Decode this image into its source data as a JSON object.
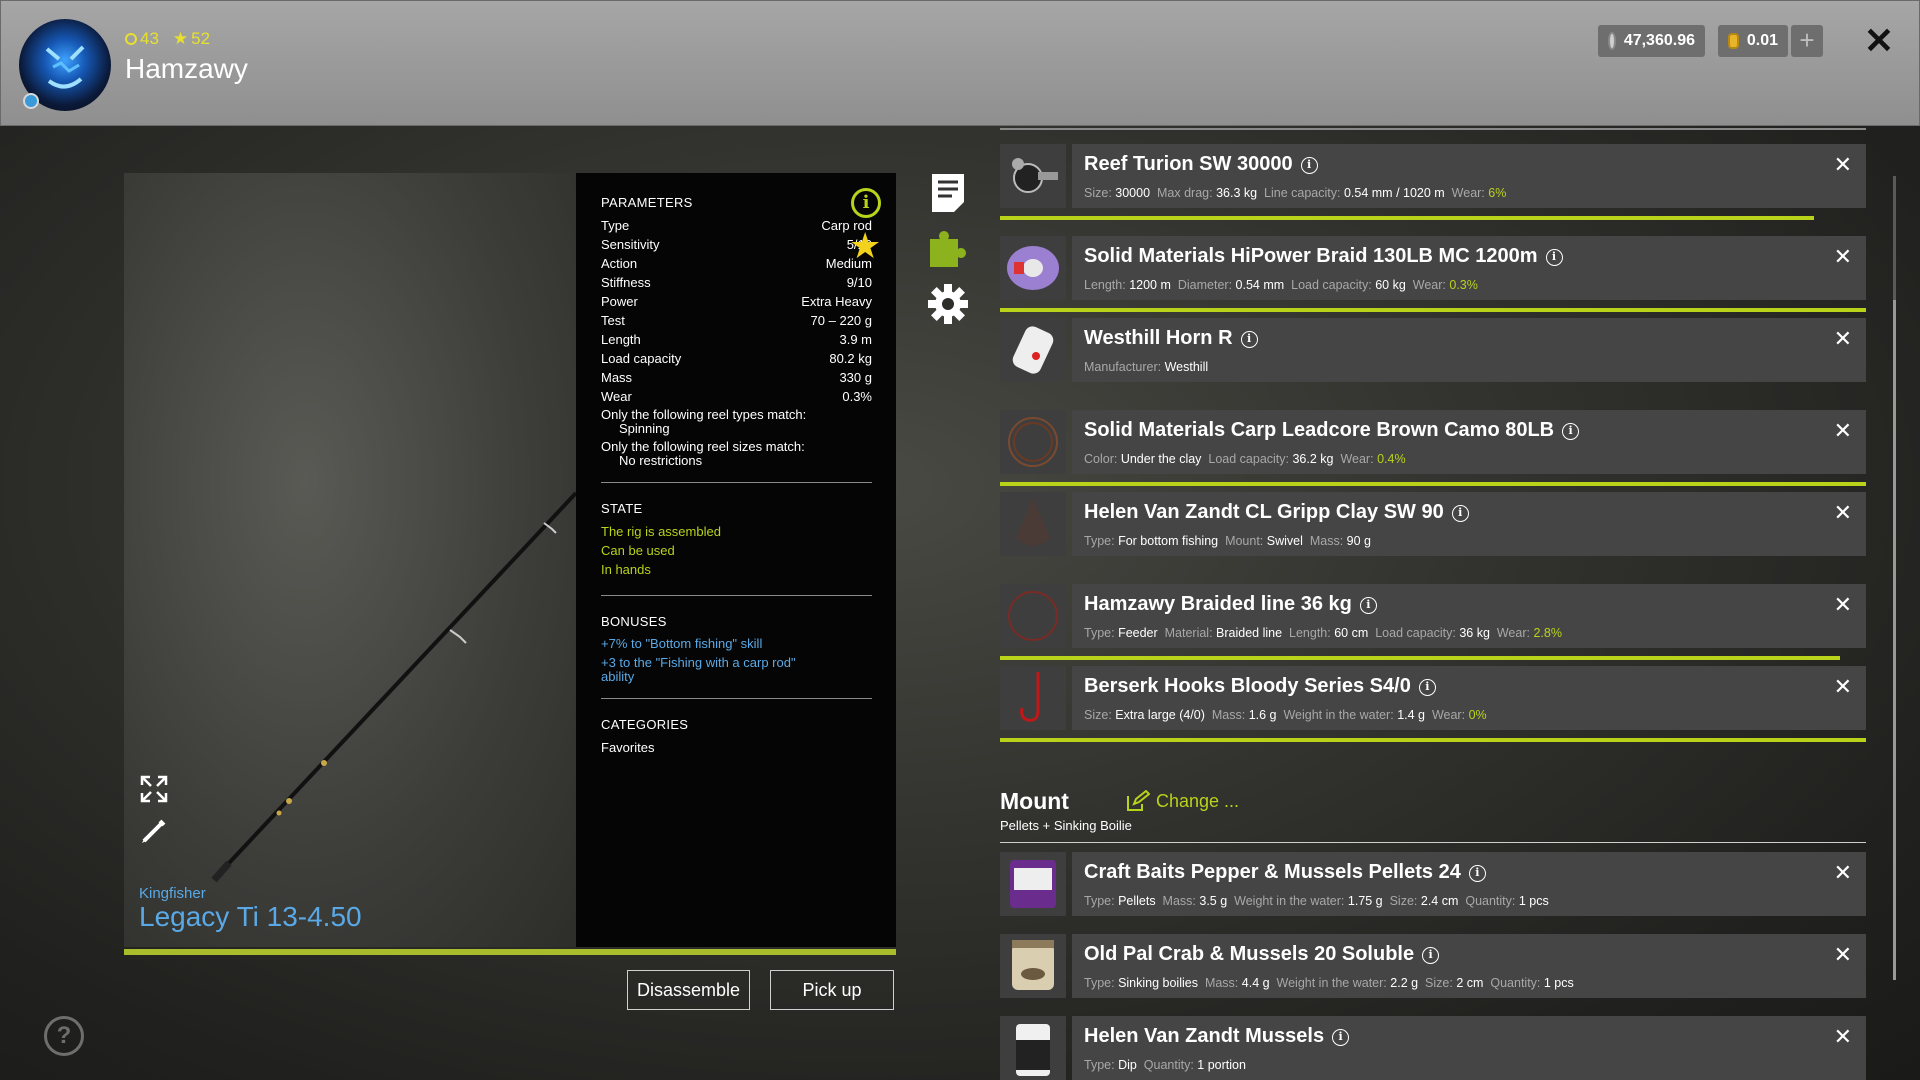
{
  "player": {
    "name": "Hamzawy",
    "level": "43",
    "rank": "52"
  },
  "currency": {
    "silver": "47,360.96",
    "gold": "0.01"
  },
  "rod": {
    "brand": "Kingfisher",
    "name": "Legacy Ti 13-4.50"
  },
  "parameters": {
    "heading": "PARAMETERS",
    "rows": [
      {
        "k": "Type",
        "v": "Carp rod"
      },
      {
        "k": "Sensitivity",
        "v": "5/10"
      },
      {
        "k": "Action",
        "v": "Medium"
      },
      {
        "k": "Stiffness",
        "v": "9/10"
      },
      {
        "k": "Power",
        "v": "Extra Heavy"
      },
      {
        "k": "Test",
        "v": "70 – 220 g"
      },
      {
        "k": "Length",
        "v": "3.9 m"
      },
      {
        "k": "Load capacity",
        "v": "80.2 kg"
      },
      {
        "k": "Mass",
        "v": "330 g"
      },
      {
        "k": "Wear",
        "v": "0.3%"
      }
    ],
    "reel_types_label": "Only the following reel types match:",
    "reel_types_value": "Spinning",
    "reel_sizes_label": "Only the following reel sizes match:",
    "reel_sizes_value": "No restrictions"
  },
  "state": {
    "heading": "STATE",
    "items": [
      "The rig is assembled",
      "Can be used",
      "In hands"
    ]
  },
  "bonuses": {
    "heading": "BONUSES",
    "items": [
      "+7% to \"Bottom fishing\" skill",
      "+3 to the \"Fishing with a carp rod\" ability"
    ]
  },
  "categories": {
    "heading": "CATEGORIES",
    "value": "Favorites"
  },
  "buttons": {
    "disassemble": "Disassemble",
    "pickup": "Pick up"
  },
  "tackle": [
    {
      "name": "Reef Turion SW 30000",
      "desc": [
        [
          "Size:",
          "30000"
        ],
        [
          "Max drag:",
          "36.3 kg"
        ],
        [
          "Line capacity:",
          "0.54 mm / 1020 m"
        ],
        [
          "Wear:",
          "6%"
        ]
      ],
      "wear_fraction": 0.94
    },
    {
      "name": "Solid Materials HiPower Braid 130LB MC 1200m",
      "desc": [
        [
          "Length:",
          "1200 m"
        ],
        [
          "Diameter:",
          "0.54 mm"
        ],
        [
          "Load capacity:",
          "60 kg"
        ],
        [
          "Wear:",
          "0.3%"
        ]
      ],
      "wear_fraction": 1.0
    },
    {
      "name": "Westhill Horn R",
      "desc": [
        [
          "Manufacturer:",
          "Westhill"
        ]
      ],
      "wear_fraction": null
    },
    {
      "name": "Solid Materials Carp Leadcore Brown Camo 80LB",
      "desc": [
        [
          "Color:",
          "Under the clay"
        ],
        [
          "Load capacity:",
          "36.2 kg"
        ],
        [
          "Wear:",
          "0.4%"
        ]
      ],
      "wear_fraction": 1.0
    },
    {
      "name": "Helen Van Zandt CL Gripp Clay SW 90",
      "desc": [
        [
          "Type:",
          "For bottom fishing"
        ],
        [
          "Mount:",
          "Swivel"
        ],
        [
          "Mass:",
          "90 g"
        ]
      ],
      "wear_fraction": null
    },
    {
      "name": "Hamzawy Braided line 36 kg",
      "desc": [
        [
          "Type:",
          "Feeder"
        ],
        [
          "Material:",
          "Braided line"
        ],
        [
          "Length:",
          "60 cm"
        ],
        [
          "Load capacity:",
          "36 kg"
        ],
        [
          "Wear:",
          "2.8%"
        ]
      ],
      "wear_fraction": 0.97
    },
    {
      "name": "Berserk Hooks Bloody Series S4/0",
      "desc": [
        [
          "Size:",
          "Extra large (4/0)"
        ],
        [
          "Mass:",
          "1.6 g"
        ],
        [
          "Weight in the water:",
          "1.4 g"
        ],
        [
          "Wear:",
          "0%"
        ]
      ],
      "wear_fraction": 1.0
    }
  ],
  "mount": {
    "title": "Mount",
    "change": "Change ...",
    "subtitle": "Pellets + Sinking Boilie"
  },
  "baits": [
    {
      "name": "Craft Baits Pepper & Mussels Pellets 24",
      "desc": [
        [
          "Type:",
          "Pellets"
        ],
        [
          "Mass:",
          "3.5 g"
        ],
        [
          "Weight in the water:",
          "1.75 g"
        ],
        [
          "Size:",
          "2.4 cm"
        ],
        [
          "Quantity:",
          "1 pcs"
        ]
      ]
    },
    {
      "name": "Old Pal Crab & Mussels 20 Soluble",
      "desc": [
        [
          "Type:",
          "Sinking boilies"
        ],
        [
          "Mass:",
          "4.4 g"
        ],
        [
          "Weight in the water:",
          "2.2 g"
        ],
        [
          "Size:",
          "2 cm"
        ],
        [
          "Quantity:",
          "1 pcs"
        ]
      ]
    },
    {
      "name": "Helen Van Zandt Mussels",
      "desc": [
        [
          "Type:",
          "Dip"
        ],
        [
          "Quantity:",
          "1 portion"
        ]
      ]
    }
  ],
  "colors": {
    "accent": "#b9d21a",
    "link": "#5aa9e6",
    "star": "#f2d21c"
  },
  "icons": [
    "document-icon",
    "puzzle-icon",
    "gear-icon",
    "info-icon",
    "star-icon",
    "expand-icon",
    "edit-icon",
    "help-icon",
    "close-icon"
  ]
}
